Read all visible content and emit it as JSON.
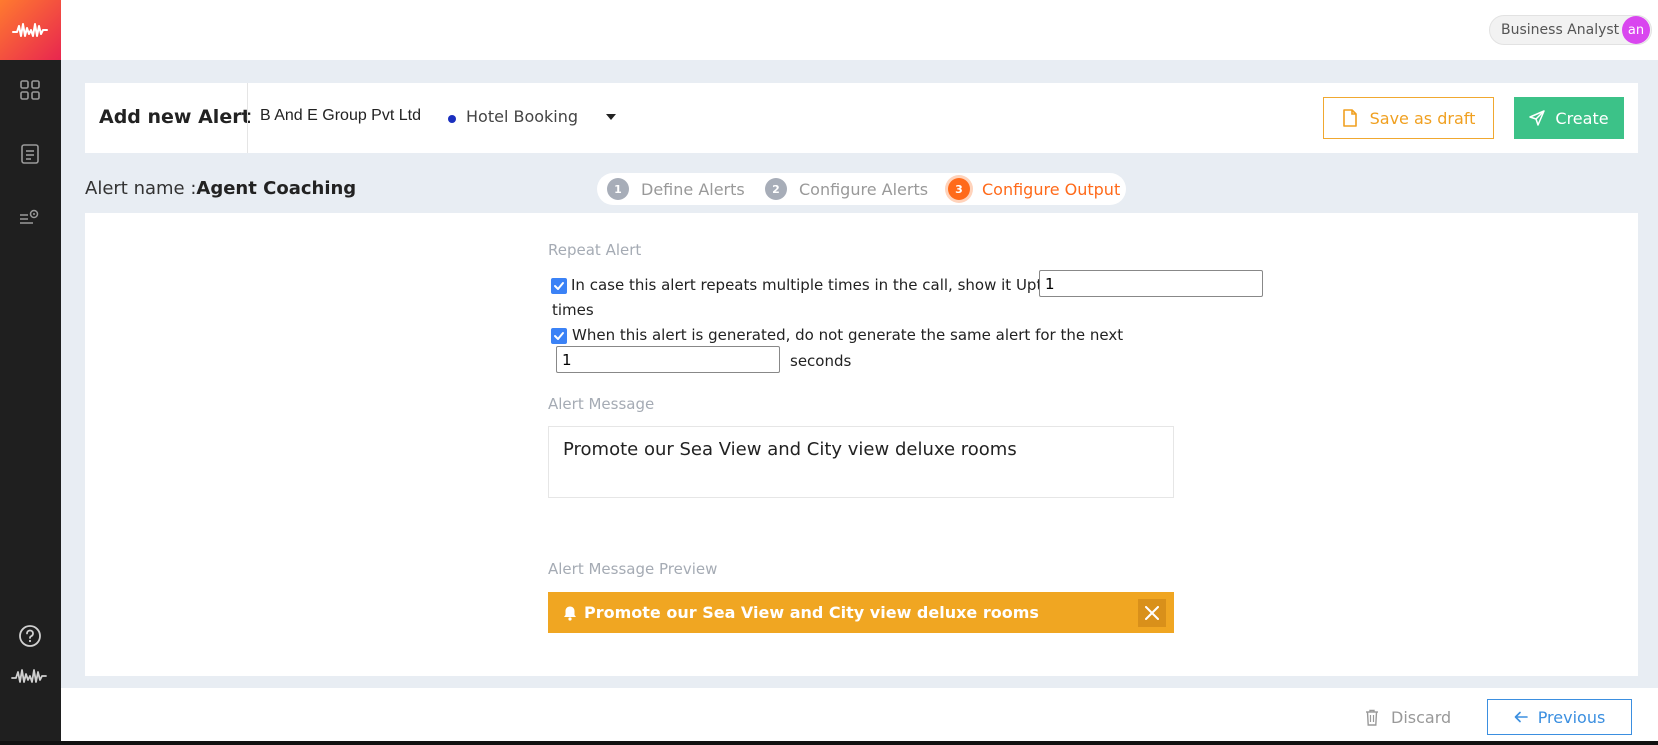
{
  "user": {
    "role": "Business Analyst",
    "initials": "an"
  },
  "header": {
    "title": "Add new Alert",
    "org": "B And E Group Pvt Ltd",
    "project": "Hotel Booking",
    "save_draft": "Save as draft",
    "create": "Create"
  },
  "alert": {
    "name_label": "Alert name :",
    "name": "Agent Coaching"
  },
  "steps": [
    {
      "num": "1",
      "label": "Define Alerts"
    },
    {
      "num": "2",
      "label": "Configure Alerts"
    },
    {
      "num": "3",
      "label": "Configure Output"
    }
  ],
  "repeat": {
    "section_label": "Repeat Alert",
    "option1_text": "In case this alert repeats multiple times in the call, show it Upto",
    "option1_value": "1",
    "option1_suffix": "times",
    "option2_text": "When this alert is generated, do not generate the same alert for the next",
    "option2_value": "1",
    "option2_suffix": "seconds"
  },
  "message": {
    "section_label": "Alert Message",
    "text": "Promote our Sea View and City view deluxe rooms"
  },
  "preview": {
    "section_label": "Alert Message Preview",
    "text": "Promote our Sea View and City view deluxe rooms"
  },
  "footer": {
    "discard": "Discard",
    "previous": "Previous"
  },
  "colors": {
    "accent_orange": "#ff6a1a",
    "create_green": "#3cc288",
    "preview_bg": "#f0a622",
    "link_blue": "#3b8fe0"
  },
  "icons": [
    "logo-wave-icon",
    "dashboard-icon",
    "list-icon",
    "settings-list-icon",
    "help-icon",
    "bell-icon",
    "close-icon",
    "trash-icon",
    "arrow-left-icon",
    "file-icon",
    "send-icon"
  ]
}
